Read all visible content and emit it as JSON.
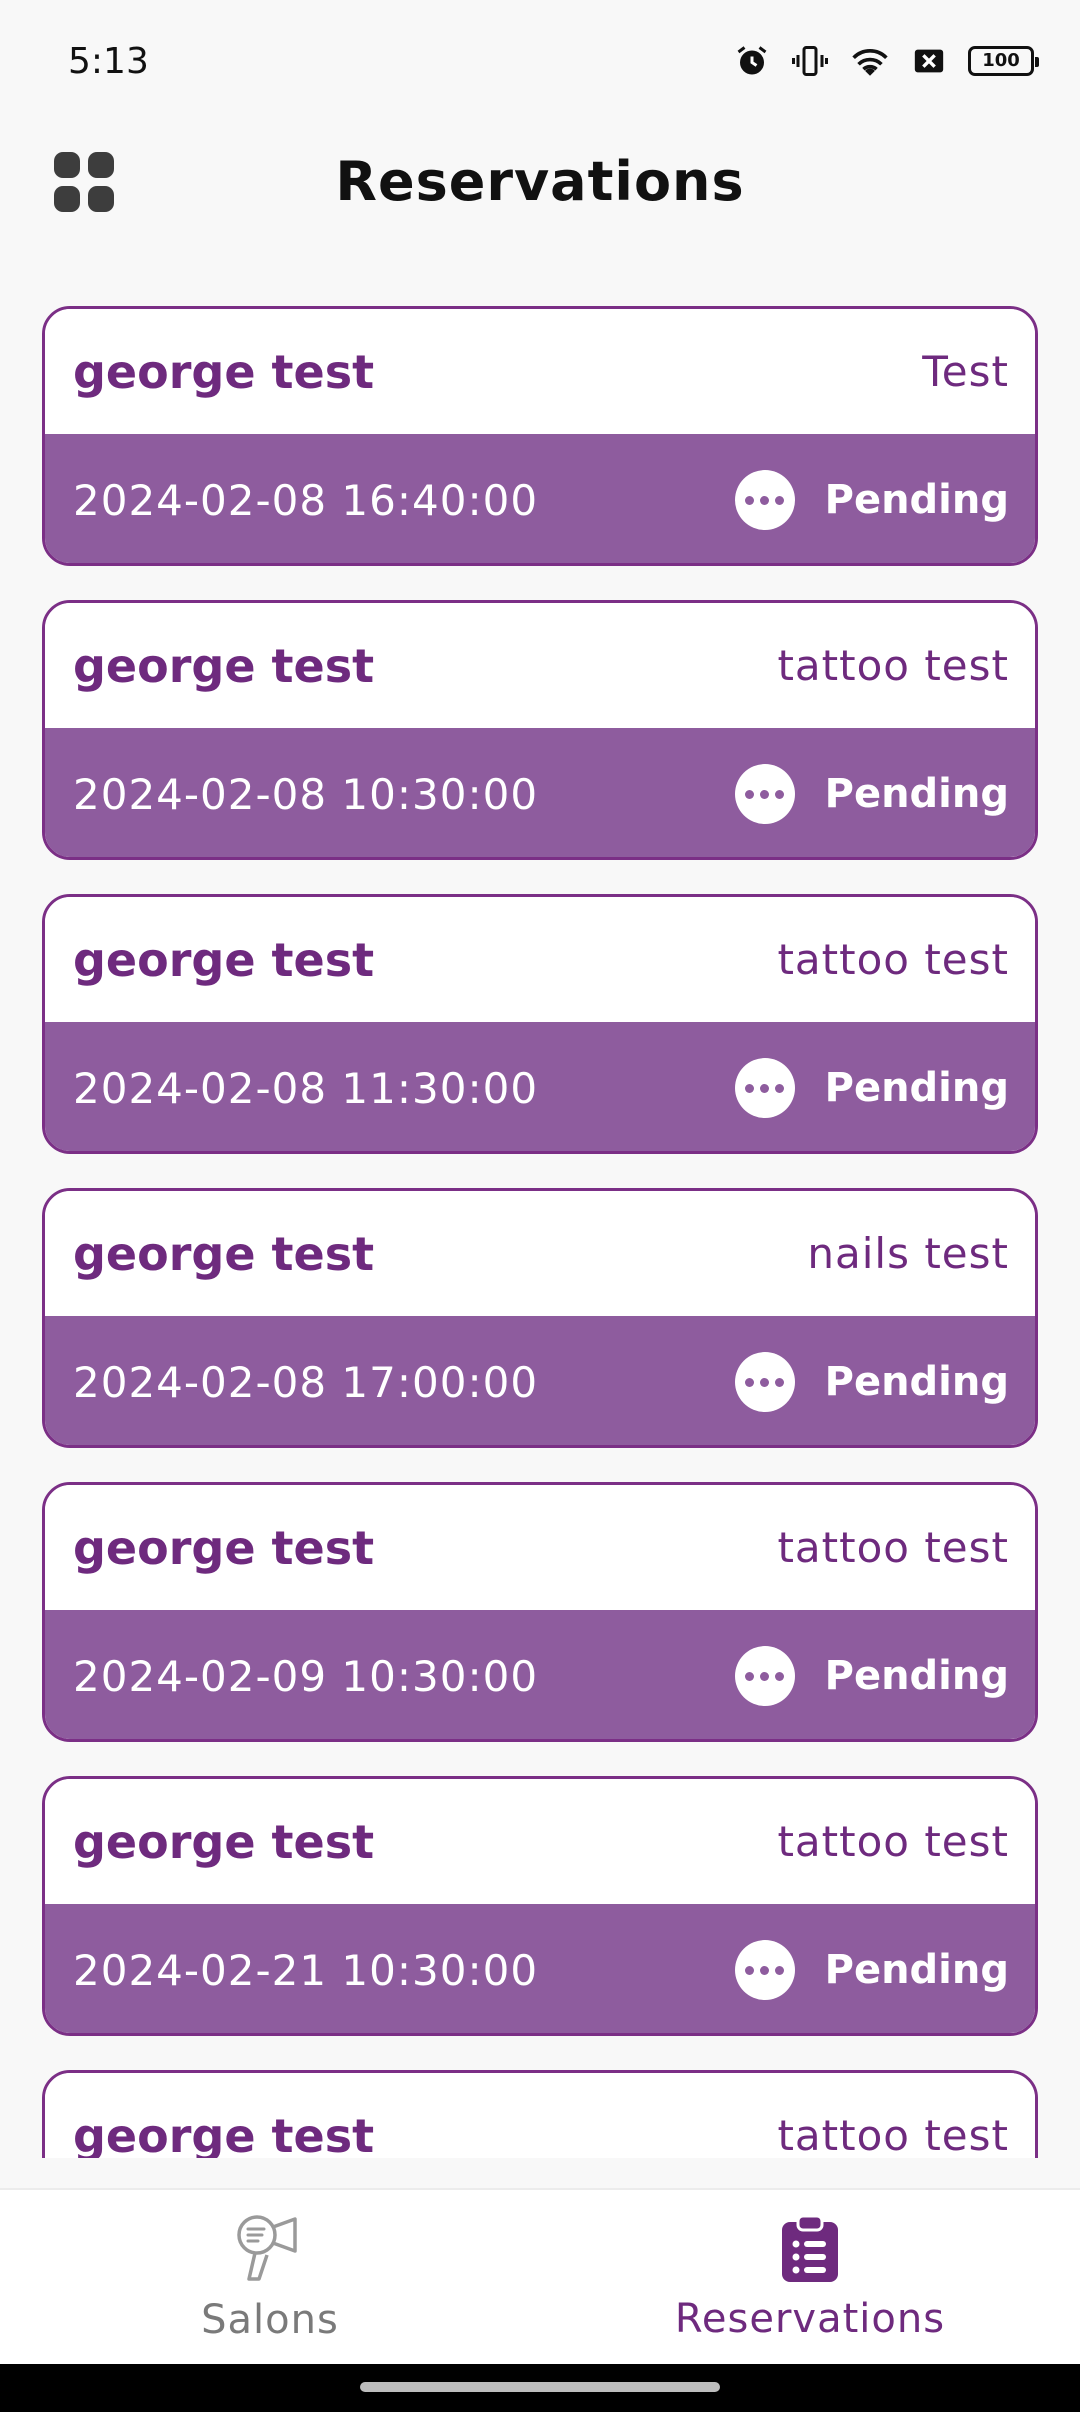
{
  "status_bar": {
    "time": "5:13",
    "battery": "100"
  },
  "app_bar": {
    "title": "Reservations"
  },
  "reservations": [
    {
      "customer": "george test",
      "service": "Test",
      "datetime": "2024-02-08 16:40:00",
      "status": "Pending"
    },
    {
      "customer": "george test",
      "service": "tattoo test",
      "datetime": "2024-02-08 10:30:00",
      "status": "Pending"
    },
    {
      "customer": "george test",
      "service": "tattoo test",
      "datetime": "2024-02-08 11:30:00",
      "status": "Pending"
    },
    {
      "customer": "george test",
      "service": "nails test",
      "datetime": "2024-02-08 17:00:00",
      "status": "Pending"
    },
    {
      "customer": "george test",
      "service": "tattoo test",
      "datetime": "2024-02-09 10:30:00",
      "status": "Pending"
    },
    {
      "customer": "george test",
      "service": "tattoo test",
      "datetime": "2024-02-21 10:30:00",
      "status": "Pending"
    },
    {
      "customer": "george test",
      "service": "tattoo test",
      "datetime": "",
      "status": ""
    }
  ],
  "bottom_nav": {
    "items": [
      {
        "label": "Salons",
        "icon": "hair-dryer-icon",
        "active": false
      },
      {
        "label": "Reservations",
        "icon": "clipboard-list-icon",
        "active": true
      }
    ]
  },
  "colors": {
    "accent": "#6e2a7e",
    "card_band": "#8e5c9e",
    "card_border": "#7b2f86",
    "nav_inactive": "#7a7a7a"
  }
}
